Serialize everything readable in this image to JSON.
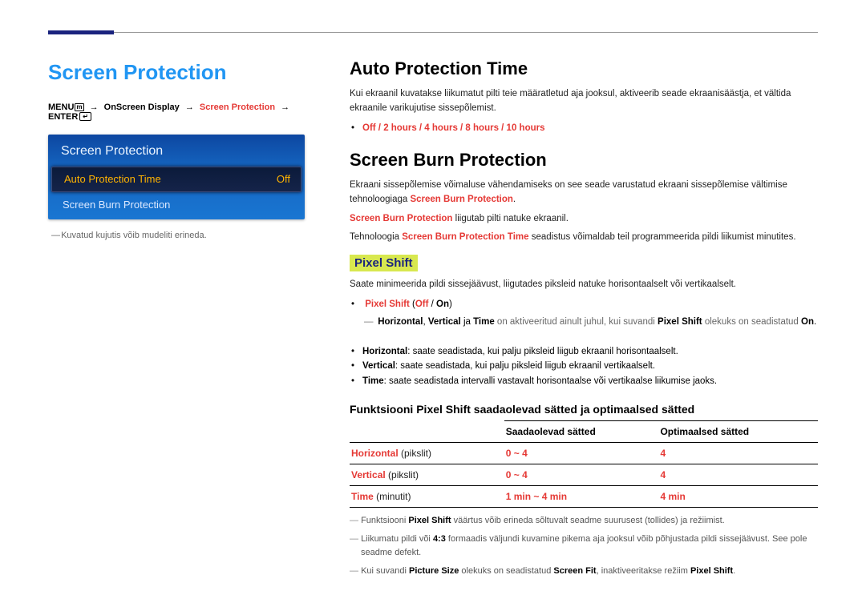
{
  "header_title": "Screen Protection",
  "breadcrumb": {
    "menu": "MENU",
    "arrow": "→",
    "p1": "OnScreen Display",
    "p2": "Screen Protection",
    "enter": "ENTER"
  },
  "menu_panel": {
    "title": "Screen Protection",
    "row1_label": "Auto Protection Time",
    "row1_value": "Off",
    "row2_label": "Screen Burn Protection"
  },
  "left_footnote": "Kuvatud kujutis võib mudeliti erineda.",
  "section_auto": {
    "heading": "Auto Protection Time",
    "para": "Kui ekraanil kuvatakse liikumatut pilti teie määratletud aja jooksul, aktiveerib seade ekraanisäästja, et vältida ekraanile varikujutise sissepõlemist.",
    "options_line": "Off / 2 hours / 4 hours / 8 hours / 10 hours"
  },
  "section_burn": {
    "heading": "Screen Burn Protection",
    "p1_a": "Ekraani sissepõlemise võimaluse vähendamiseks on see seade varustatud ekraani sissepõlemise vältimise tehnoloogiaga ",
    "p1_b": "Screen Burn Protection",
    "p2_a": "Screen Burn Protection",
    "p2_b": " liigutab pilti natuke ekraanil.",
    "p3_a": "Tehnoloogia ",
    "p3_b": "Screen Burn Protection Time",
    "p3_c": " seadistus võimaldab teil programmeerida pildi liikumist minutites."
  },
  "pixel_shift": {
    "heading": "Pixel Shift",
    "intro": "Saate minimeerida pildi sissejäävust, liigutades piksleid natuke horisontaalselt või vertikaalselt.",
    "li1_a": "Pixel Shift",
    "li1_b": " (",
    "li1_off": "Off",
    "li1_sep": " / ",
    "li1_on": "On",
    "li1_c": ")",
    "sub_a": "Horizontal",
    "sub_b": "Vertical",
    "sub_c": "Time",
    "sub_txt1": " on aktiveeritud ainult juhul, kui suvandi ",
    "sub_ps": "Pixel Shift",
    "sub_txt2": " olekuks on seadistatud ",
    "sub_on": "On",
    "li2_a": "Horizontal",
    "li2_b": ": saate seadistada, kui palju piksleid liigub ekraanil horisontaalselt.",
    "li3_a": "Vertical",
    "li3_b": ": saate seadistada, kui palju piksleid liigub ekraanil vertikaalselt.",
    "li4_a": "Time",
    "li4_b": ": saate seadistada intervalli vastavalt horisontaalse või vertikaalse liikumise jaoks."
  },
  "table": {
    "title": "Funktsiooni Pixel Shift saadaolevad sätted ja optimaalsed sätted",
    "col_avail": "Saadaolevad sätted",
    "col_opt": "Optimaalsed sätted",
    "r1_label": "Horizontal",
    "r1_unit": " (pikslit)",
    "r1_avail": "0 ~ 4",
    "r1_opt": "4",
    "r2_label": "Vertical",
    "r2_unit": " (pikslit)",
    "r2_avail": "0 ~ 4",
    "r2_opt": "4",
    "r3_label": "Time",
    "r3_unit": " (minutit)",
    "r3_avail": "1 min ~ 4 min",
    "r3_opt": "4 min"
  },
  "notes": {
    "n1_a": "Funktsiooni ",
    "n1_b": "Pixel Shift",
    "n1_c": " väärtus võib erineda sõltuvalt seadme suurusest (tollides) ja režiimist.",
    "n2_a": "Liikumatu pildi või ",
    "n2_b": "4:3",
    "n2_c": " formaadis väljundi kuvamine pikema aja jooksul võib põhjustada pildi sissejäävust. See pole seadme defekt.",
    "n3_a": "Kui suvandi ",
    "n3_b": "Picture Size",
    "n3_c": " olekuks on seadistatud ",
    "n3_d": "Screen Fit",
    "n3_e": ", inaktiveeritakse režiim ",
    "n3_f": "Pixel Shift",
    "n3_g": "."
  }
}
